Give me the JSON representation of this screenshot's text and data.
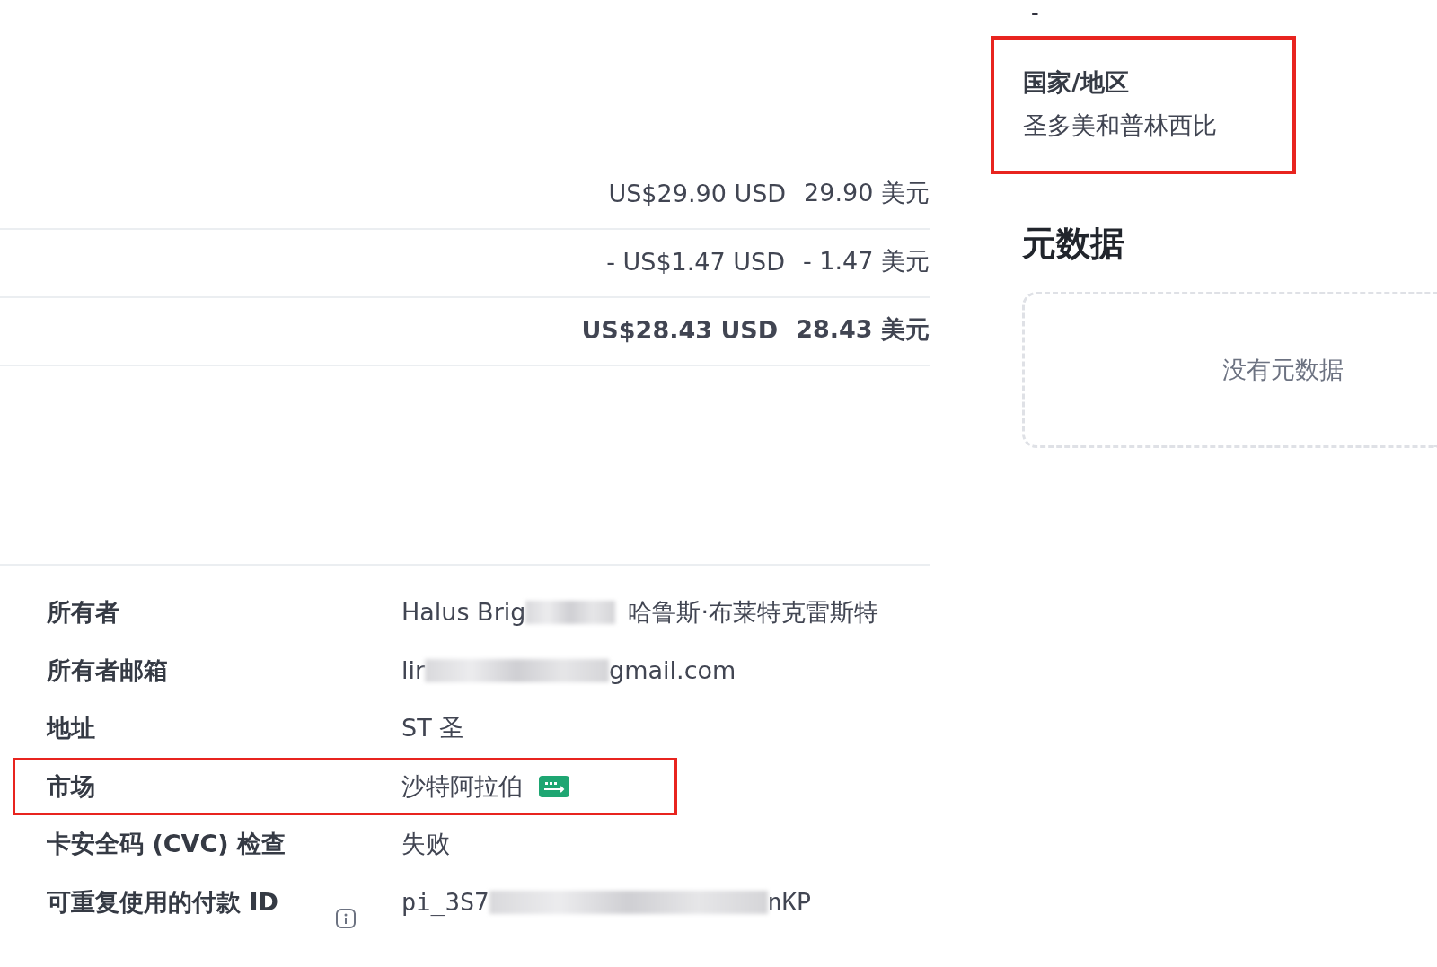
{
  "amounts": [
    {
      "usd": "US$29.90 USD",
      "local": "29.90 美元",
      "bold": false
    },
    {
      "usd": "- US$1.47 USD",
      "local": "- 1.47 美元",
      "bold": false
    },
    {
      "usd": "US$28.43 USD",
      "local": "28.43 美元",
      "bold": true
    }
  ],
  "details": [
    {
      "label": "所有者",
      "highlighted": false,
      "parts": [
        {
          "kind": "text",
          "text": "Halus Brig"
        },
        {
          "kind": "redacted"
        },
        {
          "kind": "text",
          "text": "哈鲁斯·布莱特克雷斯特"
        }
      ]
    },
    {
      "label": "所有者邮箱",
      "highlighted": false,
      "parts": [
        {
          "kind": "text",
          "text": "lir"
        },
        {
          "kind": "redacted"
        },
        {
          "kind": "text",
          "text": "gmail.com"
        }
      ]
    },
    {
      "label": "地址",
      "highlighted": false,
      "parts": [
        {
          "kind": "text",
          "text": "ST  圣"
        }
      ]
    },
    {
      "label": "市场",
      "highlighted": true,
      "parts": [
        {
          "kind": "text",
          "text": "沙特阿拉伯"
        },
        {
          "kind": "card_icon"
        }
      ]
    },
    {
      "label": "卡安全码 (CVC) 检查",
      "highlighted": false,
      "parts": [
        {
          "kind": "text",
          "text": "失败"
        }
      ]
    },
    {
      "label": "可重复使用的付款 ID",
      "highlighted": false,
      "info_icon": true,
      "mono": true,
      "parts": [
        {
          "kind": "text",
          "text": "pi_3S7"
        },
        {
          "kind": "redacted"
        },
        {
          "kind": "text",
          "text": "nKP"
        }
      ]
    }
  ],
  "side": {
    "dash": "-",
    "field": {
      "label": "国家/地区",
      "value": "圣多美和普林西比",
      "highlighted": true
    }
  },
  "metadata": {
    "title": "元数据",
    "empty": "没有元数据"
  }
}
